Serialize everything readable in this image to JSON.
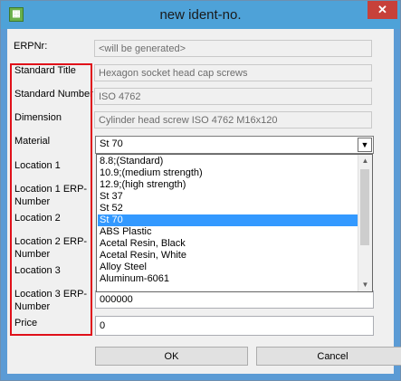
{
  "window": {
    "title": "new ident-no.",
    "close_glyph": "✕",
    "app_icon": "grid-icon"
  },
  "labels": {
    "erpnr": "ERPNr:",
    "standard_title": "Standard Title",
    "standard_number": "Standard Number",
    "dimension": "Dimension",
    "material": "Material",
    "location1": "Location 1",
    "location1_erp_line1": "Location 1 ERP-",
    "location1_erp_line2": "Number",
    "location2": "Location 2",
    "location2_erp_line1": "Location 2 ERP-",
    "location2_erp_line2": "Number",
    "location3": "Location 3",
    "location3_erp_line1": "Location 3 ERP-",
    "location3_erp_line2": "Number",
    "price": "Price"
  },
  "fields": {
    "erpnr": "<will be generated>",
    "standard_title": "Hexagon socket head cap screws",
    "standard_number": "ISO 4762",
    "dimension": "Cylinder head screw ISO 4762 M16x120",
    "location3_erp": "000000",
    "price": "0"
  },
  "material": {
    "selected": "St 70",
    "options": [
      "8.8;(Standard)",
      "10.9;(medium strength)",
      "12.9;(high strength)",
      "St 37",
      "St 52",
      "St 70",
      "ABS Plastic",
      "Acetal Resin, Black",
      "Acetal Resin, White",
      "Alloy Steel",
      "Aluminum-6061"
    ],
    "selected_index": 5
  },
  "buttons": {
    "ok": "OK",
    "cancel": "Cancel"
  },
  "colors": {
    "titlebar": "#4ea2d8",
    "highlight": "#e0101a",
    "selection": "#3399ff",
    "close": "#c7413a"
  }
}
